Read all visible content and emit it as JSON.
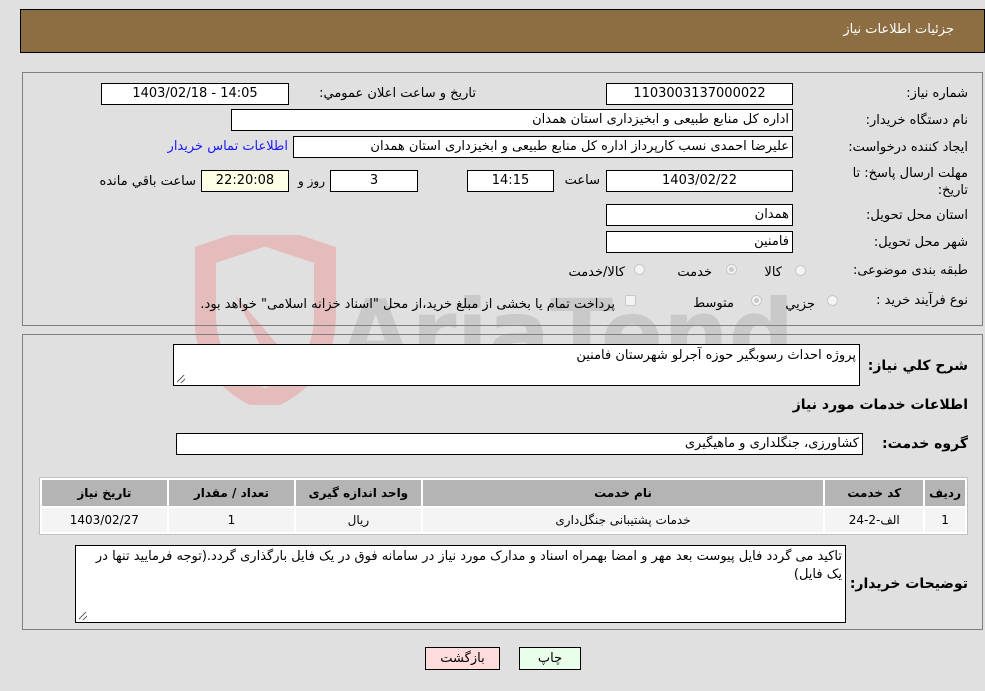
{
  "header": {
    "title": "جزئیات اطلاعات نیاز"
  },
  "fields": {
    "need_number_label": "شماره نیاز:",
    "need_number": "1103003137000022",
    "announce_label": "تاريخ و ساعت اعلان عمومي:",
    "announce_value": "1403/02/18 - 14:05",
    "buyer_org_label": "نام دستگاه خریدار:",
    "buyer_org": "اداره کل منابع طبیعی و ابخیزداری استان همدان",
    "requester_label": "ایجاد کننده درخواست:",
    "requester": "علیرضا احمدی نسب کارپرداز اداره کل منابع طبیعی و ابخیزداری استان همدان",
    "contact_link": "اطلاعات تماس خریدار",
    "deadline_label": "مهلت ارسال پاسخ: تا تاریخ:",
    "deadline_date": "1403/02/22",
    "time_label": "ساعت",
    "deadline_time": "14:15",
    "days_value": "3",
    "days_label": "روز و",
    "remaining_time": "22:20:08",
    "remaining_label": "ساعت باقي مانده",
    "province_label": "استان محل تحویل:",
    "province": "همدان",
    "city_label": "شهر محل تحویل:",
    "city": "فامنین",
    "category_label": "طبقه بندی موضوعی:",
    "category_options": [
      "کالا",
      "خدمت",
      "کالا/خدمت"
    ],
    "category_selected": "خدمت",
    "process_label": "نوع فرآیند خرید :",
    "process_options": [
      "جزیي",
      "متوسط"
    ],
    "process_selected": "متوسط",
    "treasury_note": "پرداخت تمام یا بخشی از مبلغ خرید،از محل \"اسناد خزانه اسلامی\" خواهد بود.",
    "treasury_checked": false
  },
  "description": {
    "label": "شرح كلي نياز:",
    "value": "پروژه احداث رسوبگیر حوزه آجرلو شهرستان فامنین"
  },
  "services_section": {
    "title": "اطلاعات خدمات مورد نیاز",
    "group_label": "گروه خدمت:",
    "group_value": "کشاورزی، جنگلداری و ماهیگیری",
    "table": {
      "headers": [
        "ردیف",
        "کد خدمت",
        "نام خدمت",
        "واحد اندازه گیری",
        "تعداد / مقدار",
        "تاریخ نیاز"
      ],
      "rows": [
        [
          "1",
          "الف-2-24",
          "خدمات پشتیبانی جنگل‌داری",
          "ریال",
          "1",
          "1403/02/27"
        ]
      ]
    }
  },
  "buyer_notes": {
    "label": "توضیحات خریدار:",
    "value": "تاکید می گردد فایل پیوست بعد مهر و امضا بهمراه اسناد و مدارک مورد نیاز در سامانه فوق در یک فایل بارگذاری گردد.(توجه فرمایید تنها در یک فایل)"
  },
  "buttons": {
    "print": "چاپ",
    "back": "بازگشت"
  },
  "watermark": {
    "text": "AriaTender.neT"
  }
}
